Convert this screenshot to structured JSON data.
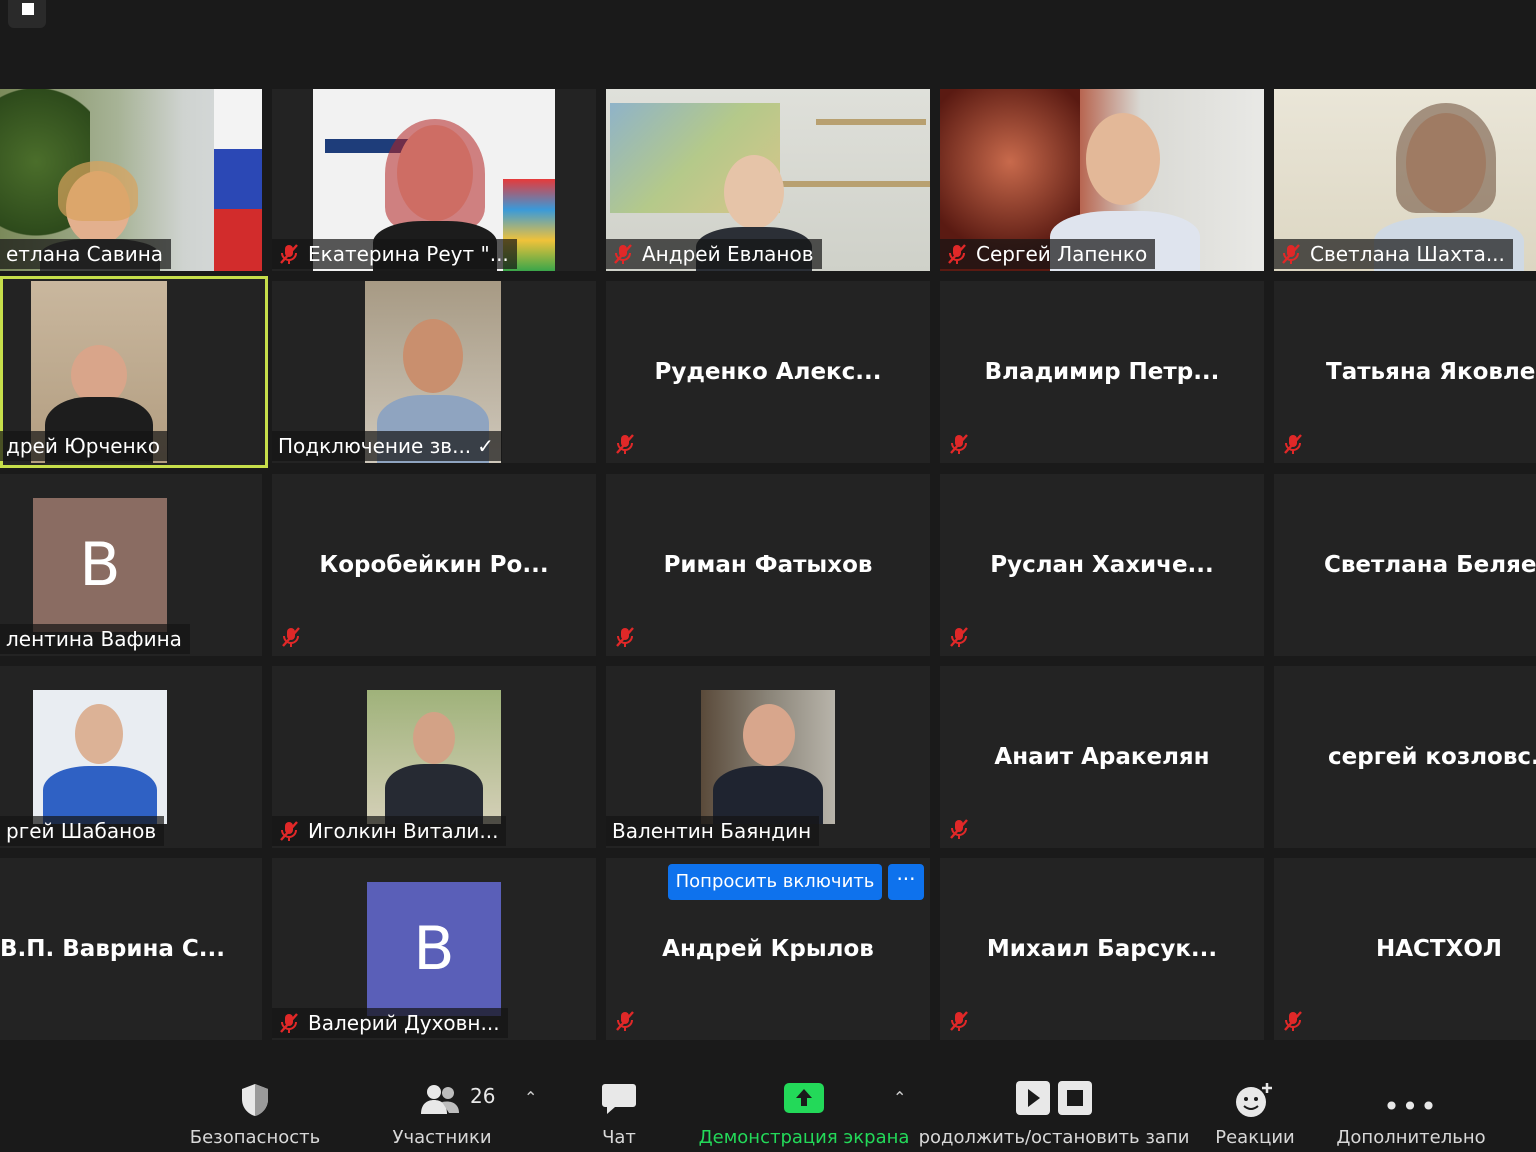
{
  "participants": [
    {
      "name": "етлана Савина",
      "muted": false
    },
    {
      "name": "Екатерина Реут \"...",
      "muted": true
    },
    {
      "name": "Андрей Евланов",
      "muted": true
    },
    {
      "name": "Сергей Лапенко",
      "muted": true
    },
    {
      "name": "Светлана Шахта...",
      "muted": true
    },
    {
      "name": "дрей Юрченко",
      "muted": false
    },
    {
      "name": "Подключение зв...",
      "muted": false
    },
    {
      "name": "Руденко  Алекс...",
      "muted": true
    },
    {
      "name": "Владимир  Петр...",
      "muted": true
    },
    {
      "name": "Татьяна  Яковле...",
      "muted": true
    },
    {
      "name": "лентина Вафина",
      "muted": false,
      "avatar_letter": "В"
    },
    {
      "name": "Коробейкин  Ро...",
      "muted": true
    },
    {
      "name": "Риман Фатыхов",
      "muted": true
    },
    {
      "name": "Руслан  Хахиче...",
      "muted": true
    },
    {
      "name": "Светлана  Беляе...",
      "muted": false
    },
    {
      "name": "ргей Шабанов",
      "muted": false
    },
    {
      "name": "Иголкин Витали...",
      "muted": true
    },
    {
      "name": "Валентин Баяндин",
      "muted": false
    },
    {
      "name": "Анаит Аракелян",
      "muted": true
    },
    {
      "name": "сергей  козловс...",
      "muted": false
    },
    {
      "name": "В.П.  Ваврина  С...",
      "muted": false
    },
    {
      "name": "Валерий Духовн...",
      "muted": true,
      "avatar_letter": "В"
    },
    {
      "name": "Андрей Крылов",
      "muted": true
    },
    {
      "name": "Михаил  Барсук...",
      "muted": true
    },
    {
      "name": "НАСТХОЛ",
      "muted": true
    }
  ],
  "ask_unmute_label": "Попросить включить",
  "more_label": "···",
  "check_mark": "✓",
  "toolbar": {
    "security": "Безопасность",
    "participants": "Участники",
    "participants_count": "26",
    "chat": "Чат",
    "share": "Демонстрация экрана",
    "record": "родолжить/остановить запи",
    "reactions": "Реакции",
    "more": "Дополнительно"
  },
  "colors": {
    "accent_green": "#23d959",
    "active_border": "#c6de4a",
    "mute_red": "#e02828",
    "button_blue": "#0e72ed",
    "avatar_brown": "#8a6c62",
    "avatar_purple": "#5a5fb8"
  }
}
